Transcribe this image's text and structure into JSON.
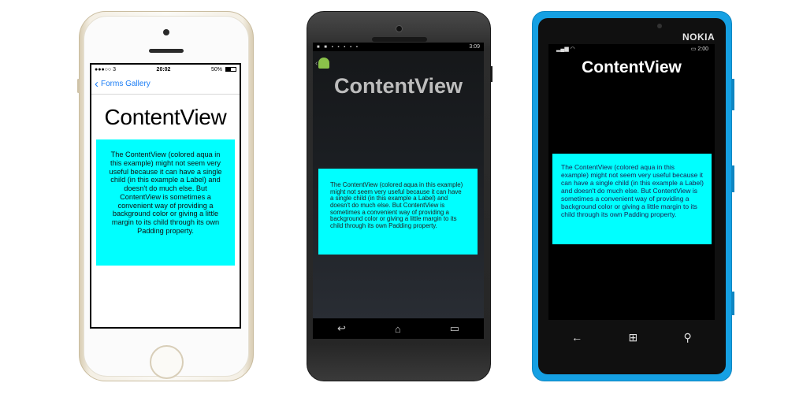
{
  "iphone": {
    "status": {
      "carrier": "●●●○○ 3",
      "time": "20:02",
      "battery": "50%"
    },
    "nav_back_label": "Forms Gallery",
    "title": "ContentView",
    "body_text": "The ContentView (colored aqua in this example) might not seem very useful because it can have a single child (in this example a Label) and doesn't do much else. But ContentView is sometimes a convenient way of providing a background color or giving a little margin to its child through its own Padding property.",
    "box_color": "#00ffff"
  },
  "android": {
    "status": {
      "time": "3:09"
    },
    "title": "ContentView",
    "body_text": "The ContentView (colored aqua in this example) might not seem very useful because it can have a single child (in this example a Label) and doesn't do much else. But ContentView is sometimes a convenient way of providing a background color or giving a little margin to its child through its own Padding property.",
    "nav": {
      "back_icon": "back-icon",
      "home_icon": "home-icon",
      "recents_icon": "recents-icon"
    }
  },
  "nokia": {
    "brand": "NOKIA",
    "status": {
      "time": "2:00"
    },
    "title": "ContentView",
    "body_text": "The ContentView (colored aqua in this example) might not seem very useful because it can have a single child (in this example a Label) and doesn't do much else. But ContentView is sometimes a convenient way of providing a background color or giving a little margin to its child through its own Padding property.",
    "nav": {
      "back_icon": "back-arrow-icon",
      "start_icon": "windows-start-icon",
      "search_icon": "search-icon"
    }
  }
}
